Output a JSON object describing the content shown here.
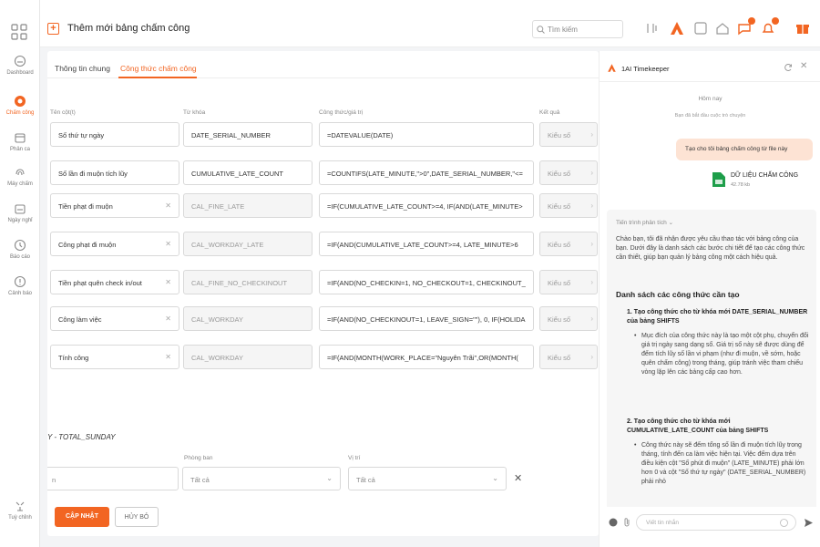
{
  "topbar": {
    "title": "Thêm mới bảng chấm công",
    "search_placeholder": "Tìm kiếm"
  },
  "sidebar": {
    "items": [
      {
        "label": "Dashboard",
        "icon": "dashboard-icon"
      },
      {
        "label": "Chấm công",
        "icon": "clock-icon",
        "active": true
      },
      {
        "label": "Phân ca",
        "icon": "calendar-icon"
      },
      {
        "label": "Máy chấm",
        "icon": "fingerprint-icon"
      },
      {
        "label": "Ngày nghỉ",
        "icon": "calendar-off-icon"
      },
      {
        "label": "Báo cáo",
        "icon": "report-icon"
      },
      {
        "label": "Cảnh báo",
        "icon": "alert-icon"
      }
    ],
    "bottom_label": "Tuỳ chỉnh"
  },
  "tabs": [
    {
      "label": "Thông tin chung"
    },
    {
      "label": "Công thức chấm công",
      "active": true
    }
  ],
  "table": {
    "headers": [
      "Tên cột(t)",
      "Từ khóa",
      "Công thức/giá trị",
      "Kết quả"
    ],
    "rows": [
      {
        "name": "Số thứ tự ngày",
        "key": "DATE_SERIAL_NUMBER",
        "formula": "=DATEVALUE(DATE)",
        "result": "Kiểu số",
        "editable": true
      },
      {
        "name": "Số lần đi muộn tích lũy",
        "key": "CUMULATIVE_LATE_COUNT",
        "formula": "=COUNTIFS(LATE_MINUTE,\">0\",DATE_SERIAL_NUMBER,\"<=",
        "result": "Kiểu số",
        "editable": true
      },
      {
        "name": "Tiền phạt đi muộn",
        "key": "CAL_FINE_LATE",
        "formula": "=IF(CUMULATIVE_LATE_COUNT>=4, IF(AND(LATE_MINUTE>",
        "result": "Kiểu số",
        "editable": false
      },
      {
        "name": "Công phạt đi muộn",
        "key": "CAL_WORKDAY_LATE",
        "formula": "=IF(AND(CUMULATIVE_LATE_COUNT>=4, LATE_MINUTE>6",
        "result": "Kiểu số",
        "editable": false
      },
      {
        "name": "Tiền phạt quên check in/out",
        "key": "CAL_FINE_NO_CHECKINOUT",
        "formula": "=IF(AND(NO_CHECKIN=1, NO_CHECKOUT=1, CHECKINOUT_",
        "result": "Kiểu số",
        "editable": false
      },
      {
        "name": "Công làm việc",
        "key": "CAL_WORKDAY",
        "formula": "=IF(AND(NO_CHECKINOUT=1, LEAVE_SIGN=\"\"), 0, IF(HOLIDA",
        "result": "Kiểu số",
        "editable": false
      },
      {
        "name": "Tính công",
        "key": "CAL_WORKDAY",
        "formula": "=IF(AND(MONTH(WORK_PLACE=\"Nguyên Trãi\",OR(MONTH(",
        "result": "Kiểu số",
        "editable": false
      }
    ]
  },
  "section": {
    "title": "Y - TOTAL_SUNDAY"
  },
  "filters": {
    "first_value": "n",
    "dept_label": "Phòng ban",
    "dept_value": "Tất cả",
    "pos_label": "Vị trí",
    "pos_value": "Tất cả"
  },
  "buttons": {
    "update": "CẬP NHẬT",
    "cancel": "HỦY BỎ"
  },
  "chat": {
    "title": "1AI Timekeeper",
    "date": "Hôm nay",
    "started": "Bạn đã bắt đầu cuộc trò chuyện",
    "user_msg": "Tạo cho tôi bảng chấm công từ file này",
    "file_name": "DỮ LIỆU CHẤM CÔNG",
    "file_size": "42.78 kb",
    "progress_label": "Tiến trình phân tích",
    "intro": "Chào bạn, tôi đã nhận được yêu cầu thao tác với bảng công của bạn. Dưới đây là danh sách các bước chi tiết để tạo các công thức cần thiết, giúp bạn quản lý bảng công một cách hiệu quả.",
    "heading": "Danh sách các công thức cần tạo",
    "step1_title": "1. Tạo công thức cho từ khóa mới DATE_SERIAL_NUMBER của bảng SHIFTS",
    "step1_body": "Mục đích của công thức này là tạo một cột phụ, chuyển đổi giá trị ngày sang dạng số. Giá trị số này sẽ được dùng để đếm tích lũy số lần vi phạm (như đi muộn, về sớm, hoặc quên chấm công) trong tháng, giúp tránh việc tham chiếu vòng lặp lên các bảng cấp cao hơn.",
    "step2_title": "2. Tạo công thức cho từ khóa mới CUMULATIVE_LATE_COUNT của bảng SHIFTS",
    "step2_body": "Công thức này sẽ đếm tổng số lần đi muộn tích lũy trong tháng, tính đến ca làm việc hiện tại. Việc đếm dựa trên điều kiện cột \"Số phút đi muộn\" (LATE_MINUTE) phải lớn hơn 0 và cột \"Số thứ tự ngày\" (DATE_SERIAL_NUMBER) phải nhỏ",
    "input_placeholder": "Viết tin nhắn"
  },
  "colors": {
    "accent": "#f26522",
    "file_green": "#1e9e4a"
  }
}
